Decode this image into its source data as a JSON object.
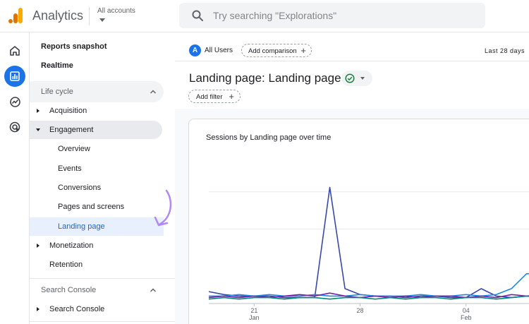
{
  "app": {
    "title": "Analytics",
    "account_picker_label": "All accounts"
  },
  "search": {
    "placeholder": "Try searching \"Explorations\""
  },
  "rail": {
    "items": [
      {
        "icon": "home-icon"
      },
      {
        "icon": "reports-icon",
        "active": true
      },
      {
        "icon": "explore-icon"
      },
      {
        "icon": "advertising-icon"
      }
    ]
  },
  "nav": {
    "reports_snapshot": "Reports snapshot",
    "realtime": "Realtime",
    "life_cycle": "Life cycle",
    "acquisition": "Acquisition",
    "engagement": "Engagement",
    "overview": "Overview",
    "events": "Events",
    "conversions": "Conversions",
    "pages_and_screens": "Pages and screens",
    "landing_page": "Landing page",
    "monetization": "Monetization",
    "retention": "Retention",
    "search_console_section": "Search Console",
    "search_console": "Search Console"
  },
  "header": {
    "segment_badge": "A",
    "segment_label": "All Users",
    "add_comparison": "Add comparison",
    "date_range": "Last 28 days",
    "page_title": "Landing page: Landing page",
    "add_filter": "Add filter"
  },
  "card": {
    "title": "Sessions by Landing page over time"
  },
  "chart_data": {
    "type": "line",
    "title": "Sessions by Landing page over time",
    "x_ticks": [
      {
        "day": "21",
        "month": "Jan"
      },
      {
        "day": "28",
        "month": ""
      },
      {
        "day": "04",
        "month": "Feb"
      }
    ],
    "series": [
      {
        "color": "#3949ab",
        "values": [
          0.08,
          0.06,
          0.05,
          0.05,
          0.05,
          0.04,
          0.04,
          0.04,
          0.78,
          0.1,
          0.06,
          0.05,
          0.05,
          0.04,
          0.05,
          0.05,
          0.04,
          0.04,
          0.1,
          0.05,
          0.04,
          0.05,
          0.05
        ]
      },
      {
        "color": "#1e88e5",
        "values": [
          0.05,
          0.05,
          0.06,
          0.05,
          0.06,
          0.05,
          0.05,
          0.06,
          0.05,
          0.05,
          0.06,
          0.05,
          0.05,
          0.05,
          0.06,
          0.05,
          0.05,
          0.06,
          0.05,
          0.06,
          0.1,
          0.2,
          0.2
        ]
      },
      {
        "color": "#7b1fa2",
        "values": [
          0.04,
          0.05,
          0.04,
          0.05,
          0.04,
          0.05,
          0.06,
          0.05,
          0.07,
          0.05,
          0.04,
          0.05,
          0.04,
          0.05,
          0.04,
          0.05,
          0.05,
          0.04,
          0.05,
          0.04,
          0.06,
          0.05,
          0.06
        ]
      },
      {
        "color": "#00897b",
        "values": [
          0.03,
          0.04,
          0.03,
          0.04,
          0.04,
          0.03,
          0.04,
          0.04,
          0.03,
          0.04,
          0.04,
          0.03,
          0.04,
          0.03,
          0.04,
          0.04,
          0.03,
          0.04,
          0.04,
          0.03,
          0.04,
          0.05,
          0.04
        ]
      }
    ],
    "grid": true
  }
}
